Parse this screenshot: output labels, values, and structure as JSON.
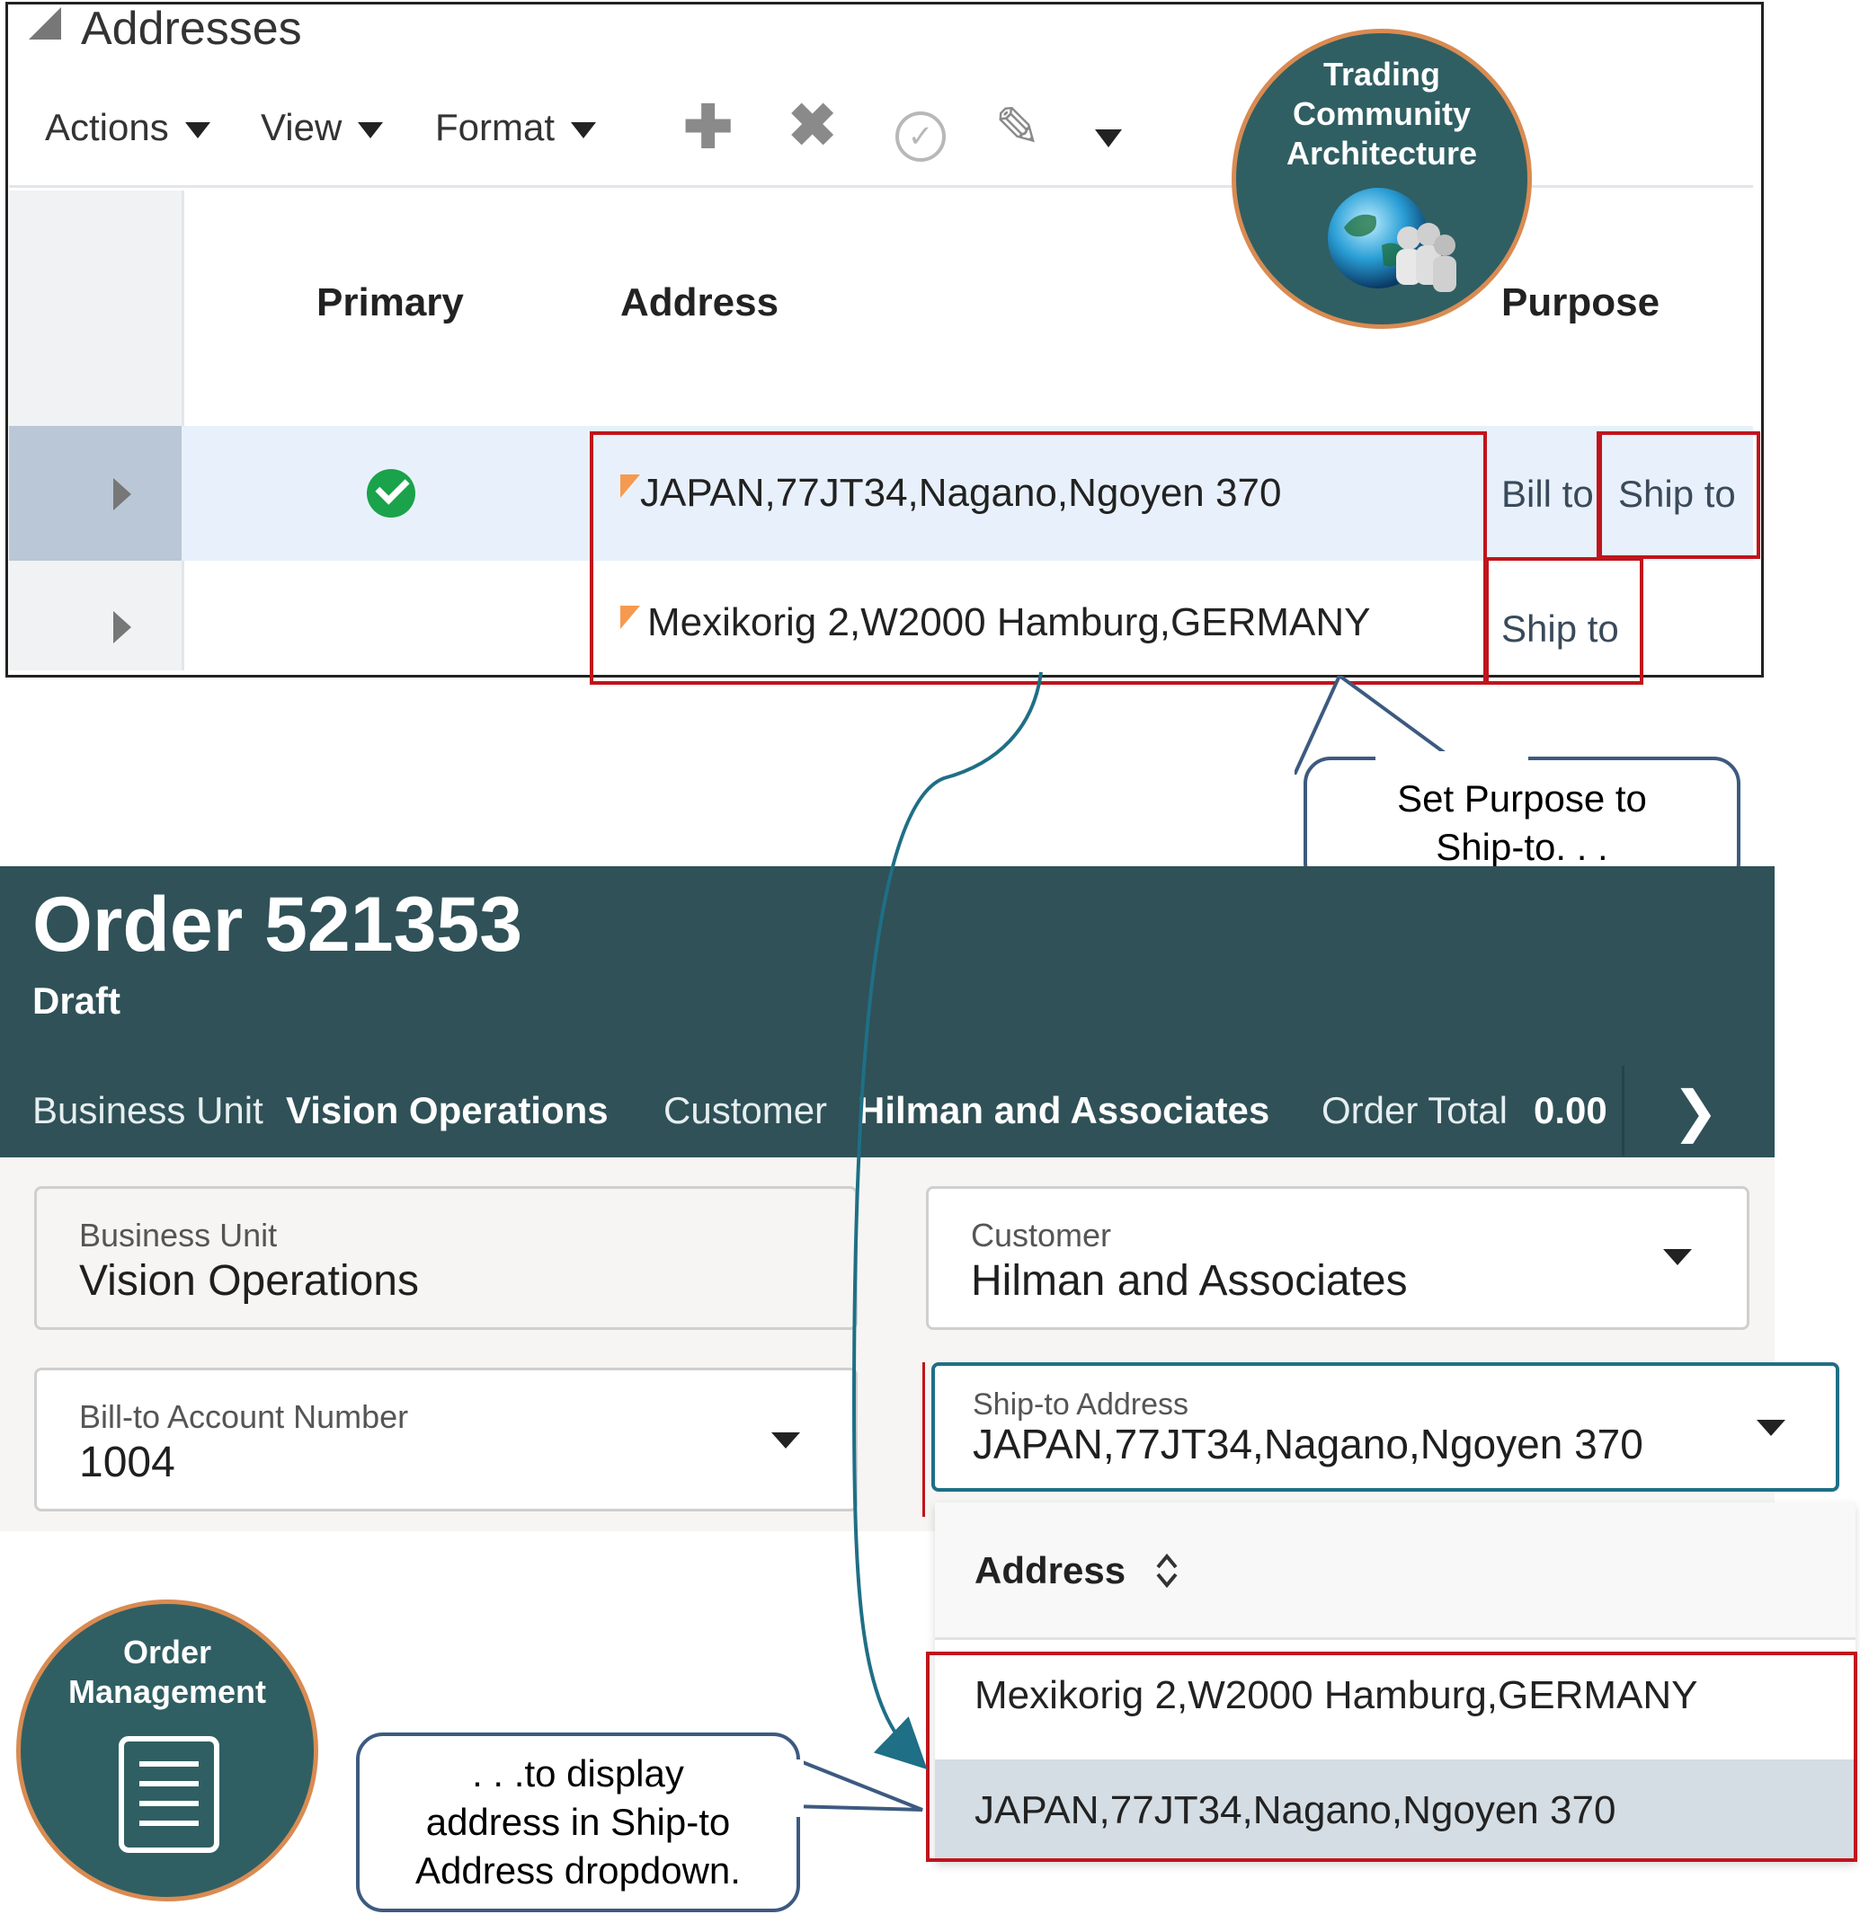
{
  "addresses_panel": {
    "title": "Addresses",
    "menus": [
      "Actions",
      "View",
      "Format"
    ],
    "toolbar_icons": [
      "add-icon",
      "delete-icon",
      "check-icon",
      "edit-icon",
      "more-caret-icon"
    ],
    "columns": {
      "primary": "Primary",
      "address": "Address",
      "purpose": "Purpose"
    },
    "rows": [
      {
        "primary": true,
        "address": "JAPAN,77JT34,Nagano,Ngoyen 370",
        "purpose_a": "Bill to,",
        "purpose_b": "Ship to"
      },
      {
        "primary": false,
        "address": "Mexikorig 2,W2000 Hamburg,GERMANY",
        "purpose_a": "Ship to",
        "purpose_b": ""
      }
    ]
  },
  "badges": {
    "tca": "Trading Community Architecture",
    "tca_lines": [
      "Trading",
      "Community",
      "Architecture"
    ],
    "om_lines": [
      "Order",
      "Management"
    ]
  },
  "callouts": {
    "purpose": [
      "Set Purpose to",
      "Ship-to. . ."
    ],
    "display": [
      ". . .to display",
      "address in Ship-to",
      "Address dropdown."
    ]
  },
  "order": {
    "title": "Order 521353",
    "status": "Draft",
    "header": {
      "business_unit_label": "Business Unit",
      "business_unit_value": "Vision Operations",
      "customer_label": "Customer",
      "customer_value": "Hilman and Associates",
      "order_total_label": "Order Total",
      "order_total_value": "0.00"
    },
    "fields": {
      "business_unit": {
        "label": "Business Unit",
        "value": "Vision Operations"
      },
      "customer": {
        "label": "Customer",
        "value": "Hilman and Associates"
      },
      "bill_to_account": {
        "label": "Bill-to Account Number",
        "value": "1004"
      },
      "ship_to_address": {
        "label": "Ship-to Address",
        "value": "JAPAN,77JT34,Nagano,Ngoyen 370"
      }
    },
    "dropdown": {
      "column": "Address",
      "options": [
        "Mexikorig 2,W2000 Hamburg,GERMANY",
        "JAPAN,77JT34,Nagano,Ngoyen 370"
      ]
    }
  },
  "colors": {
    "header_bg": "#2f5157",
    "badge_bg": "#2f5f63",
    "badge_ring": "#d98b52",
    "highlight_red": "#c0141c",
    "connector": "#1f6f86"
  }
}
